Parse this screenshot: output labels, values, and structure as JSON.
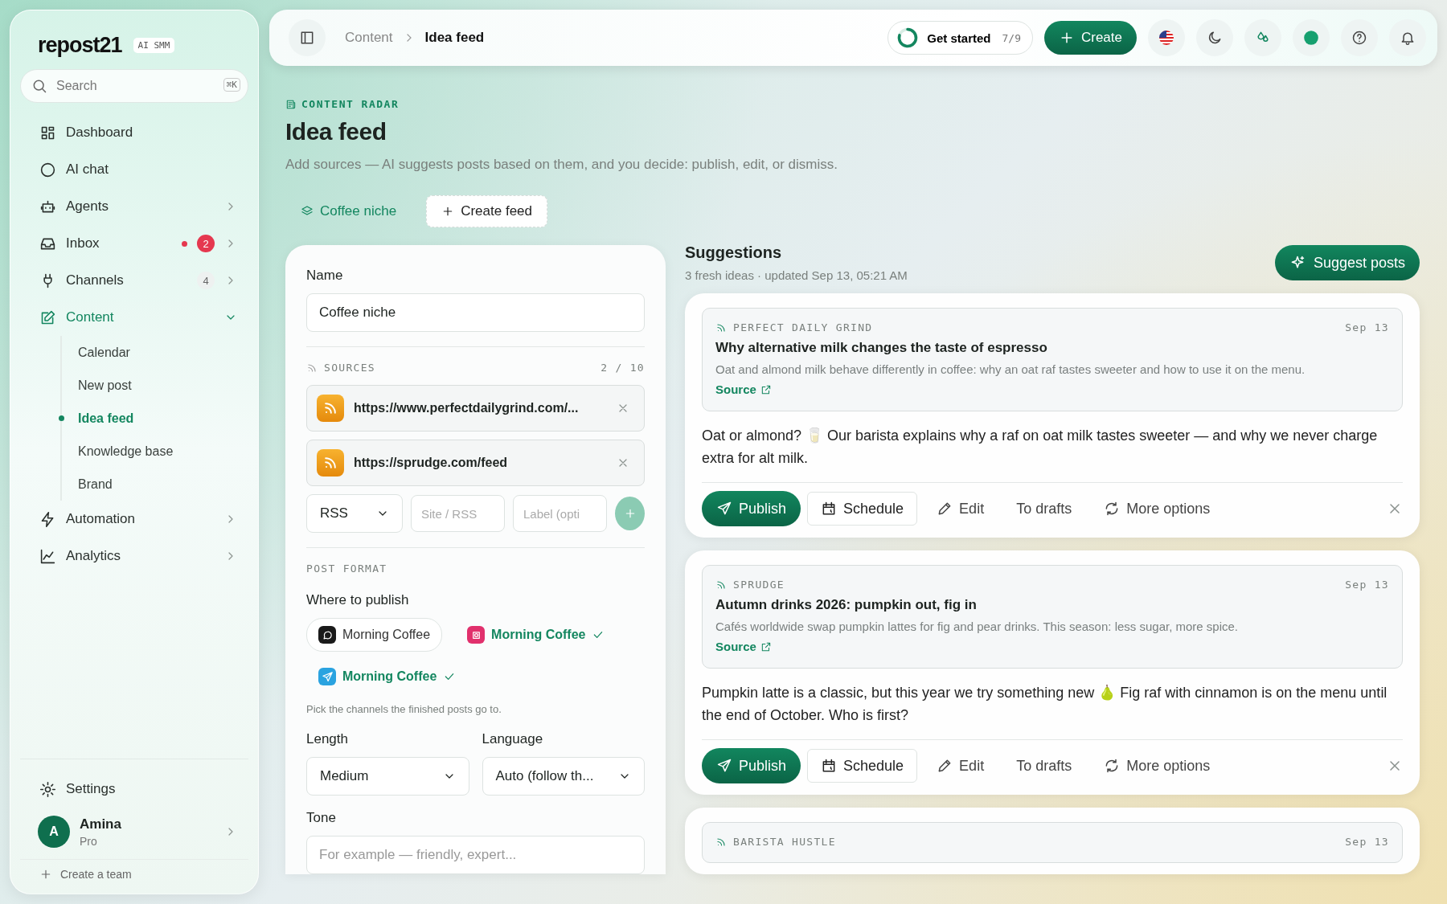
{
  "sidebar": {
    "logo": "repost21",
    "logo_badge": "AI SMM",
    "search": {
      "placeholder": "Search",
      "shortcut": "⌘K"
    },
    "items": [
      {
        "label": "Dashboard",
        "kind": "link",
        "selected": false,
        "alert": false
      },
      {
        "label": "AI chat",
        "kind": "link",
        "selected": false,
        "alert": false
      },
      {
        "label": "Agents",
        "kind": "group",
        "selected": false,
        "expanded": false,
        "alert": false
      },
      {
        "label": "Inbox",
        "kind": "group",
        "selected": false,
        "expanded": false,
        "alert": true,
        "badge": {
          "text": "2",
          "kind": "alert"
        }
      },
      {
        "label": "Channels",
        "kind": "group",
        "selected": false,
        "expanded": false,
        "alert": false,
        "badge": {
          "text": "4",
          "kind": "count"
        }
      },
      {
        "label": "Content",
        "kind": "group",
        "selected": true,
        "expanded": true,
        "alert": false,
        "children": [
          {
            "label": "Calendar",
            "selected": false
          },
          {
            "label": "New post",
            "selected": false
          },
          {
            "label": "Idea feed",
            "selected": true
          },
          {
            "label": "Knowledge base",
            "selected": false
          },
          {
            "label": "Brand",
            "selected": false
          }
        ]
      },
      {
        "label": "Automation",
        "kind": "group",
        "selected": false,
        "expanded": false,
        "alert": false
      },
      {
        "label": "Analytics",
        "kind": "group",
        "selected": false,
        "expanded": false,
        "alert": false
      }
    ],
    "settings": "Settings",
    "user": {
      "initial": "A",
      "name": "Amina",
      "plan": "Pro"
    },
    "create_team": "Create a team"
  },
  "header": {
    "breadcrumb": [
      "Content",
      "Idea feed"
    ],
    "get_started": {
      "label": "Get started",
      "progress": "7/9"
    },
    "create": "Create"
  },
  "page": {
    "eyebrow": "CONTENT RADAR",
    "title": "Idea feed",
    "subtitle": "Add sources — AI suggests posts based on them, and you decide: publish, edit, or dismiss.",
    "feeds": [
      {
        "label": "Coffee niche",
        "kind": "feed",
        "selected": true
      },
      {
        "label": "Create feed",
        "kind": "add",
        "selected": false
      }
    ]
  },
  "form": {
    "name_label": "Name",
    "name_value": "Coffee niche",
    "sources_label": "SOURCES",
    "sources_count": "2 / 10",
    "sources": [
      "https://www.perfectdailygrind.com/...",
      "https://sprudge.com/feed"
    ],
    "add_source": {
      "type": "RSS",
      "url_placeholder": "Site / RSS",
      "label_placeholder": "Label (opti"
    },
    "post_format": "POST FORMAT",
    "publish_label": "Where to publish",
    "channels": [
      {
        "name": "Morning Coffee",
        "selected": false
      },
      {
        "name": "Morning Coffee",
        "selected": true
      },
      {
        "name": "Morning Coffee",
        "selected": true
      }
    ],
    "publish_hint": "Pick the channels the finished posts go to.",
    "length_label": "Length",
    "length_value": "Medium",
    "language_label": "Language",
    "language_value": "Auto (follow th...",
    "tone_label": "Tone",
    "tone_placeholder": "For example — friendly, expert..."
  },
  "suggestions": {
    "title": "Suggestions",
    "meta": "3 fresh ideas · updated Sep 13, 05:21 AM",
    "button": "Suggest posts",
    "cards": [
      {
        "source": "PERFECT DAILY GRIND",
        "date": "Sep 13",
        "title": "Why alternative milk changes the taste of espresso",
        "summary": "Oat and almond milk behave differently in coffee: why an oat raf tastes sweeter and how to use it on the menu.",
        "link": "Source",
        "text": "Oat or almond? 🥛 Our barista explains why a raf on oat milk tastes sweeter — and why we never charge extra for alt milk.",
        "actions": [
          {
            "label": "Publish",
            "kind": "primary"
          },
          {
            "label": "Schedule",
            "kind": "outline"
          },
          {
            "label": "Edit",
            "kind": "ghost"
          },
          {
            "label": "To drafts",
            "kind": "ghost"
          },
          {
            "label": "More options",
            "kind": "ghost"
          }
        ]
      },
      {
        "source": "SPRUDGE",
        "date": "Sep 13",
        "title": "Autumn drinks 2026: pumpkin out, fig in",
        "summary": "Cafés worldwide swap pumpkin lattes for fig and pear drinks. This season: less sugar, more spice.",
        "link": "Source",
        "text": "Pumpkin latte is a classic, but this year we try something new 🍐 Fig raf with cinnamon is on the menu until the end of October. Who is first?",
        "actions": [
          {
            "label": "Publish",
            "kind": "primary"
          },
          {
            "label": "Schedule",
            "kind": "outline"
          },
          {
            "label": "Edit",
            "kind": "ghost"
          },
          {
            "label": "To drafts",
            "kind": "ghost"
          },
          {
            "label": "More options",
            "kind": "ghost"
          }
        ]
      },
      {
        "source": "BARISTA HUSTLE",
        "date": "Sep 13"
      }
    ]
  }
}
